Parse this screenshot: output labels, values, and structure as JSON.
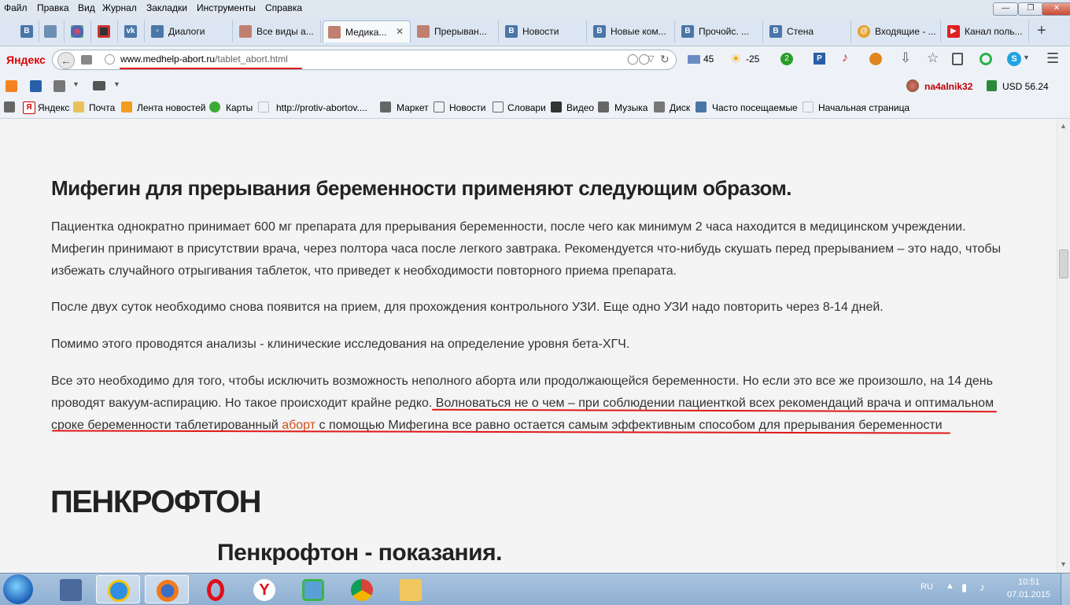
{
  "menubar": {
    "items": [
      "Файл",
      "Правка",
      "Вид",
      "Журнал",
      "Закладки",
      "Инструменты",
      "Справка"
    ]
  },
  "tabs": [
    {
      "label": "",
      "favicon": "vk-blue",
      "color": "#4a76a8"
    },
    {
      "label": "",
      "favicon": "image-grey",
      "color": "#6d8fb4"
    },
    {
      "label": "",
      "favicon": "colorful-round",
      "color": "#9a5fc2"
    },
    {
      "label": "",
      "favicon": "grid",
      "color": "#c44"
    },
    {
      "label": "",
      "favicon": "vk",
      "color": "#4a76a8"
    },
    {
      "label": "Диалоги",
      "favicon": "vk-dialog",
      "color": "#4a76a8"
    },
    {
      "label": "Все виды а...",
      "favicon": "medhelp",
      "color": "#c08070"
    },
    {
      "label": "Медика...",
      "favicon": "medhelp",
      "color": "#c08070",
      "active": true
    },
    {
      "label": "Прерыван...",
      "favicon": "medhelp",
      "color": "#c08070"
    },
    {
      "label": "Новости",
      "favicon": "vk",
      "color": "#4a76a8"
    },
    {
      "label": "Новые ком...",
      "favicon": "vk",
      "color": "#4a76a8"
    },
    {
      "label": "Прочойс. ...",
      "favicon": "vk",
      "color": "#4a76a8"
    },
    {
      "label": "Стена",
      "favicon": "vk",
      "color": "#4a76a8"
    },
    {
      "label": "Входящие - ...",
      "favicon": "mail-at",
      "color": "#e8a02a"
    },
    {
      "label": "Канал поль...",
      "favicon": "youtube",
      "color": "#e02020"
    }
  ],
  "navbar": {
    "brand": "Яндекс",
    "url_domain": "www.medhelp-abort.ru",
    "url_path": "/tablet_abort.html",
    "mail_count": "45",
    "weather": "-25",
    "badge_count": "2"
  },
  "toolbar2": {
    "user": "na4alnik32",
    "currency": "USD 56.24"
  },
  "bookmarks": [
    "Яндекс",
    "Почта",
    "Лента новостей",
    "Карты",
    "http://protiv-abortov....",
    "Маркет",
    "Новости",
    "Словари",
    "Видео",
    "Музыка",
    "Диск",
    "Часто посещаемые",
    "Начальная страница"
  ],
  "article": {
    "heading": "Мифегин для прерывания беременности применяют следующим образом.",
    "p1": "Пациентка однократно принимает 600 мг препарата для прерывания беременности, после чего как минимум 2 часа находится в медицинском учреждении. Мифегин принимают в присутствии врача, через полтора часа после легкого завтрака. Рекомендуется что-нибудь скушать перед прерыванием – это надо, чтобы избежать случайного отрыгивания таблеток, что приведет к необходимости повторного приема препарата.",
    "p2": "После двух суток необходимо снова появится на прием, для прохождения контрольного УЗИ. Еще одно УЗИ надо повторить через 8-14 дней.",
    "p3": "Помимо этого проводятся анализы - клинические исследования на определение уровня бета-ХГЧ.",
    "p4_start": "Все это необходимо для того, чтобы исключить возможность неполного аборта или продолжающейся беременности. Но если это все же произошло, на 14 день проводят вакуум-аспирацию. Но такое происходит крайне редко.",
    "p4_highlight": " Волноваться не о чем – при соблюдении пациенткой всех рекомендаций врача и оптимальном сроке беременности таблетированный ",
    "p4_link": "аборт",
    "p4_end": " с помощью Мифегина все равно остается самым эффективным способом для прерывания беременности",
    "h1": "ПЕНКРОФТОН",
    "h2": "Пенкрофтон - показания."
  },
  "taskbar": {
    "lang": "RU",
    "time": "10:51",
    "date": "07.01.2015"
  },
  "colors": {
    "link": "#d0501c",
    "annotation": "#e01818",
    "heading": "#222222"
  }
}
